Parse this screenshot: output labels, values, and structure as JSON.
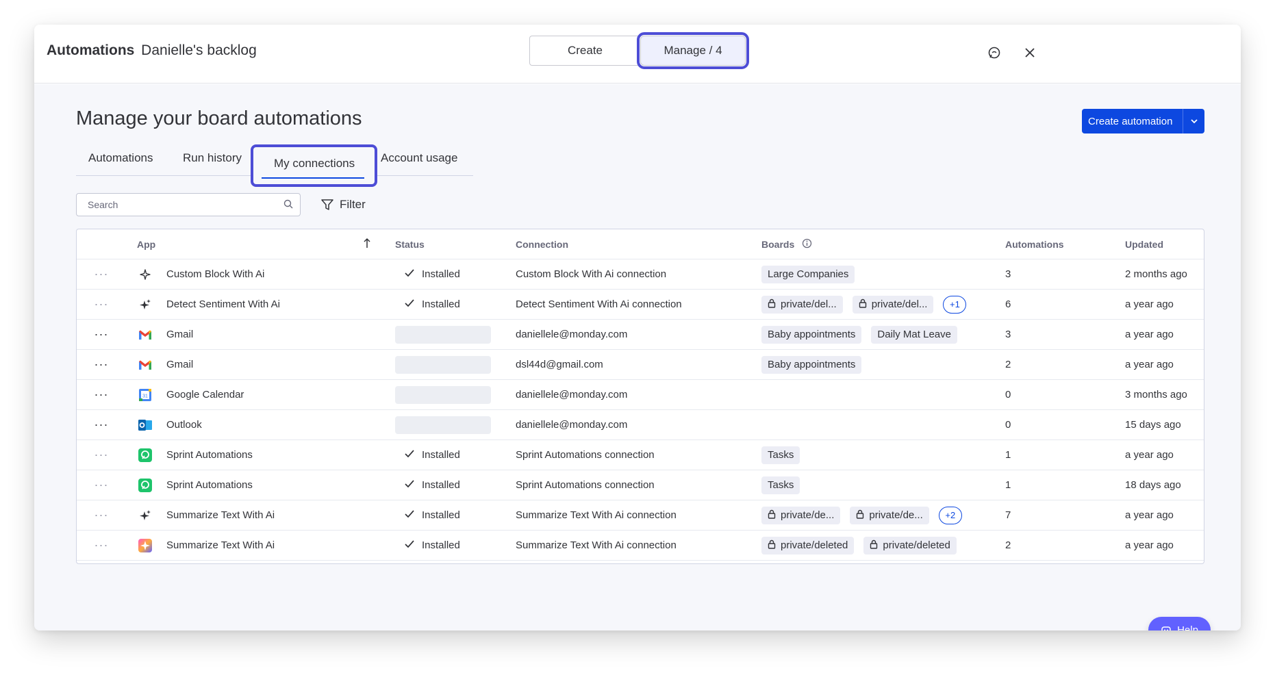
{
  "header": {
    "title_bold": "Automations",
    "title_rest": "Danielle's backlog",
    "create_label": "Create",
    "manage_label": "Manage / 4"
  },
  "page": {
    "title": "Manage your board automations",
    "create_button_label": "Create automation"
  },
  "tabs": [
    {
      "label": "Automations"
    },
    {
      "label": "Run history"
    },
    {
      "label": "My connections",
      "active": true
    },
    {
      "label": "Account usage"
    }
  ],
  "search": {
    "placeholder": "Search"
  },
  "filter_label": "Filter",
  "table": {
    "columns": [
      "App",
      "Status",
      "Connection",
      "Boards",
      "Automations",
      "Updated"
    ],
    "rows": [
      {
        "app": "Custom Block With Ai",
        "icon": "sparkle-outline-icon",
        "status": "Installed",
        "connection": "Custom Block With Ai connection",
        "boards": [
          {
            "label": "Large Companies",
            "lock": false
          }
        ],
        "more": "",
        "automations": "3",
        "updated": "2 months ago",
        "dots_dim": true
      },
      {
        "app": "Detect Sentiment With Ai",
        "icon": "sparkle-icon",
        "status": "Installed",
        "connection": "Detect Sentiment With Ai connection",
        "boards": [
          {
            "label": "private/del...",
            "lock": true
          },
          {
            "label": "private/del...",
            "lock": true
          }
        ],
        "more": "+1",
        "automations": "6",
        "updated": "a year ago",
        "dots_dim": true
      },
      {
        "app": "Gmail",
        "icon": "gmail-icon",
        "status": "",
        "connection": "daniellele@monday.com",
        "boards": [
          {
            "label": "Baby appointments",
            "lock": false
          },
          {
            "label": "Daily Mat Leave",
            "lock": false
          }
        ],
        "more": "",
        "automations": "3",
        "updated": "a year ago",
        "dots_dim": false
      },
      {
        "app": "Gmail",
        "icon": "gmail-icon",
        "status": "",
        "connection": "dsl44d@gmail.com",
        "boards": [
          {
            "label": "Baby appointments",
            "lock": false
          }
        ],
        "more": "",
        "automations": "2",
        "updated": "a year ago",
        "dots_dim": false
      },
      {
        "app": "Google Calendar",
        "icon": "google-calendar-icon",
        "status": "",
        "connection": "daniellele@monday.com",
        "boards": [],
        "more": "",
        "automations": "0",
        "updated": "3 months ago",
        "dots_dim": false
      },
      {
        "app": "Outlook",
        "icon": "outlook-icon",
        "status": "",
        "connection": "daniellele@monday.com",
        "boards": [],
        "more": "",
        "automations": "0",
        "updated": "15 days ago",
        "dots_dim": false
      },
      {
        "app": "Sprint Automations",
        "icon": "sprint-automations-icon",
        "status": "Installed",
        "connection": "Sprint Automations connection",
        "boards": [
          {
            "label": "Tasks",
            "lock": false
          }
        ],
        "more": "",
        "automations": "1",
        "updated": "a year ago",
        "dots_dim": true
      },
      {
        "app": "Sprint Automations",
        "icon": "sprint-automations-icon",
        "status": "Installed",
        "connection": "Sprint Automations connection",
        "boards": [
          {
            "label": "Tasks",
            "lock": false
          }
        ],
        "more": "",
        "automations": "1",
        "updated": "18 days ago",
        "dots_dim": true
      },
      {
        "app": "Summarize Text With Ai",
        "icon": "sparkle-icon",
        "status": "Installed",
        "connection": "Summarize Text With Ai connection",
        "boards": [
          {
            "label": "private/de...",
            "lock": true
          },
          {
            "label": "private/de...",
            "lock": true
          }
        ],
        "more": "+2",
        "automations": "7",
        "updated": "a year ago",
        "dots_dim": true
      },
      {
        "app": "Summarize Text With Ai",
        "icon": "colorful-sparkle-icon",
        "status": "Installed",
        "connection": "Summarize Text With Ai connection",
        "boards": [
          {
            "label": "private/deleted",
            "lock": true
          },
          {
            "label": "private/deleted",
            "lock": true
          }
        ],
        "more": "",
        "automations": "2",
        "updated": "a year ago",
        "dots_dim": true
      }
    ]
  },
  "help_label": "Help"
}
